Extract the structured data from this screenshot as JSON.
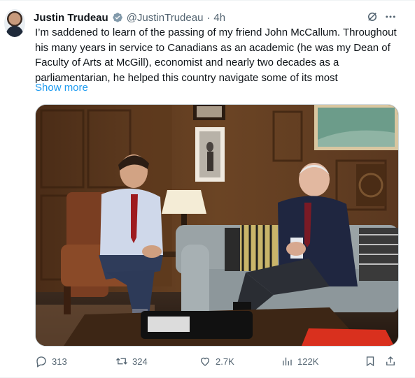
{
  "author": {
    "name": "Justin Trudeau",
    "handle": "@JustinTrudeau",
    "dot": "·",
    "time": "4h"
  },
  "tweet": {
    "text": "I’m saddened to learn of the passing of my friend John McCallum. Throughout his many years in service to Canadians as an academic (he was my Dean of Faculty of Arts at McGill), economist and nearly two decades as a parliamentarian, he helped this country navigate some of its most",
    "show_more": "Show more"
  },
  "media": {
    "icon": "photo"
  },
  "actions": {
    "replies": "313",
    "reposts": "324",
    "likes": "2.7K",
    "views": "122K"
  },
  "colors": {
    "accent": "#1d9bf0",
    "secondary_text": "#536471"
  }
}
